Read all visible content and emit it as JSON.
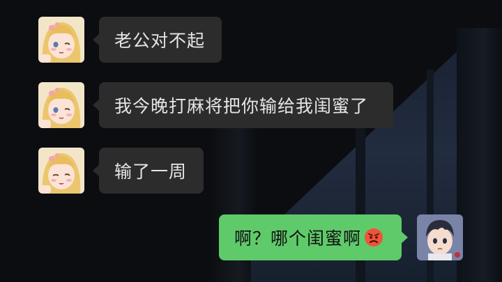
{
  "chat": {
    "messages": [
      {
        "sender": "girlfriend",
        "side": "left",
        "text": "老公对不起"
      },
      {
        "sender": "girlfriend",
        "side": "left",
        "text": "我今晚打麻将把你输给我闺蜜了"
      },
      {
        "sender": "girlfriend",
        "side": "left",
        "text": "输了一周"
      },
      {
        "sender": "boyfriend",
        "side": "right",
        "text": "啊？哪个闺蜜啊",
        "emoji": "angry-face-icon"
      }
    ]
  },
  "colors": {
    "background": "#0b0d10",
    "left_bubble": "#2c2c2c",
    "right_bubble": "#5fca6a"
  }
}
